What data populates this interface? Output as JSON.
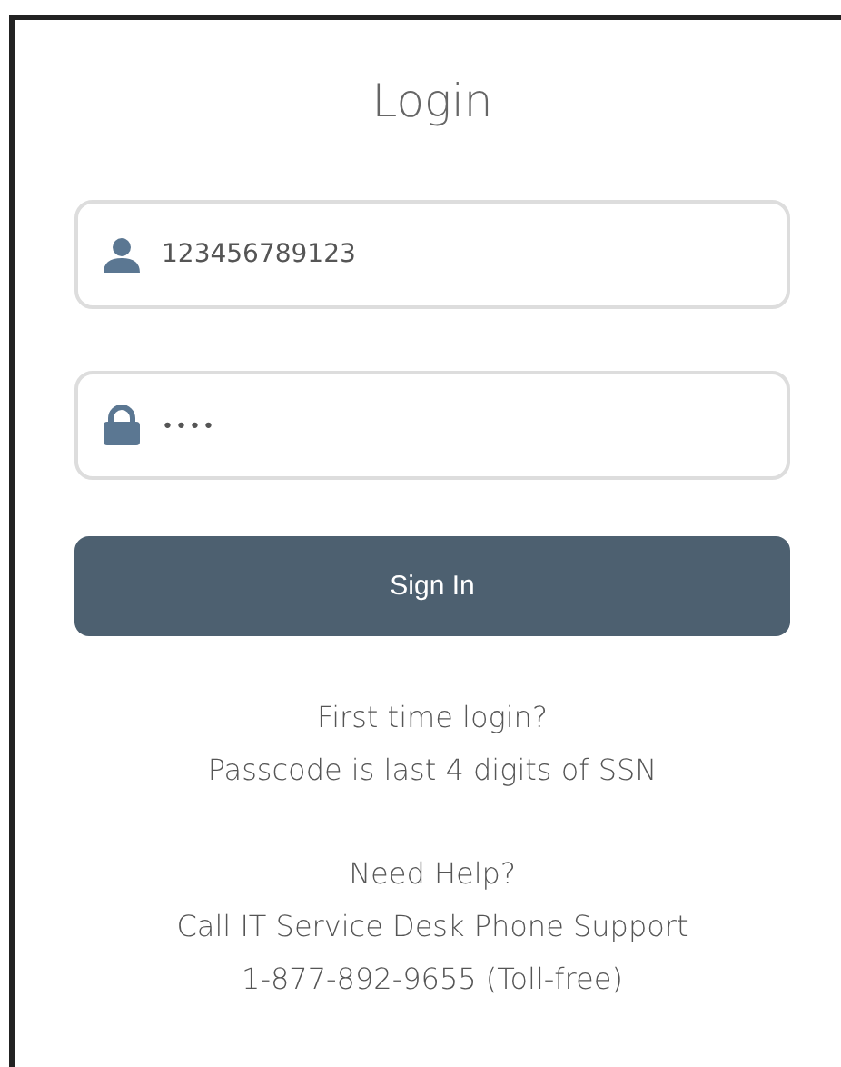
{
  "title": "Login",
  "fields": [
    {
      "kind": "user",
      "value": "123456789123"
    },
    {
      "kind": "password",
      "value": "••••"
    }
  ],
  "button": "Sign In",
  "notes": [
    [
      "First time login?",
      "Passcode is last 4 digits of SSN"
    ],
    [
      "Need Help?",
      "Call IT Service Desk Phone Support",
      "1-877-892-9655 (Toll-free)"
    ]
  ]
}
